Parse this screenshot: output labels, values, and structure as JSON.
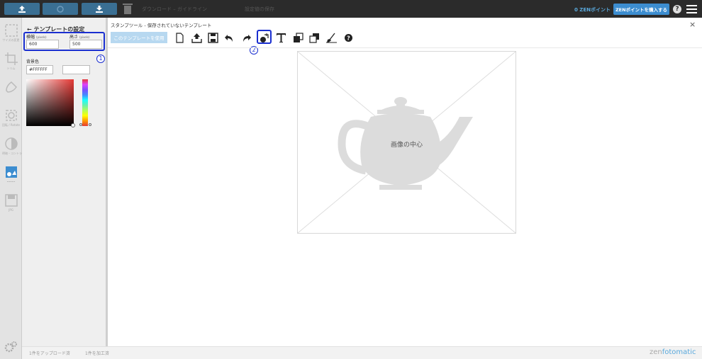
{
  "topbar": {
    "faded_item_1": "ダウンロード – ガイドライン",
    "faded_item_2": "設定値の保存",
    "zen_points": "0 ZENポイント",
    "buy_button": "ZENポイントを購入する",
    "help": "?"
  },
  "rail": {
    "items": [
      {
        "icon": "resize-icon",
        "label": "サイズの変更"
      },
      {
        "icon": "crop-icon",
        "label": "トリム"
      },
      {
        "icon": "brush-icon",
        "label": ""
      },
      {
        "icon": "rotate-icon",
        "label": "回転 / Rotate"
      },
      {
        "icon": "contrast-icon",
        "label": "明暗・コントラスト"
      },
      {
        "icon": "stamp-image-icon",
        "label": "--------"
      },
      {
        "icon": "save-icon",
        "label": "JPG"
      }
    ]
  },
  "panel": {
    "title": "テンプレートの設定",
    "width_label": "横幅",
    "width_unit": "(pixels)",
    "width_value": "600",
    "height_label": "高さ",
    "height_unit": "(pixels)",
    "height_value": "500",
    "annotation_1": "1",
    "bg_label": "背景色",
    "bg_value": "#FFFFFF"
  },
  "main": {
    "breadcrumb": "スタンプツール  -  保存されていないテンプレート",
    "use_button": "このテンプレートを使用",
    "close": "×",
    "annotation_2": "2",
    "canvas_center_label": "画像の中心",
    "tools": [
      "new-file-icon",
      "upload-icon",
      "save-icon",
      "undo-icon",
      "redo-icon",
      "add-image-icon",
      "text-icon",
      "bring-front-icon",
      "send-back-icon",
      "eraser-icon",
      "help-icon"
    ]
  },
  "footer": {
    "uploaded": "1件をアップロード済",
    "processed": "1件を加工済",
    "brand_a": "zen",
    "brand_b": "fotomatic"
  }
}
